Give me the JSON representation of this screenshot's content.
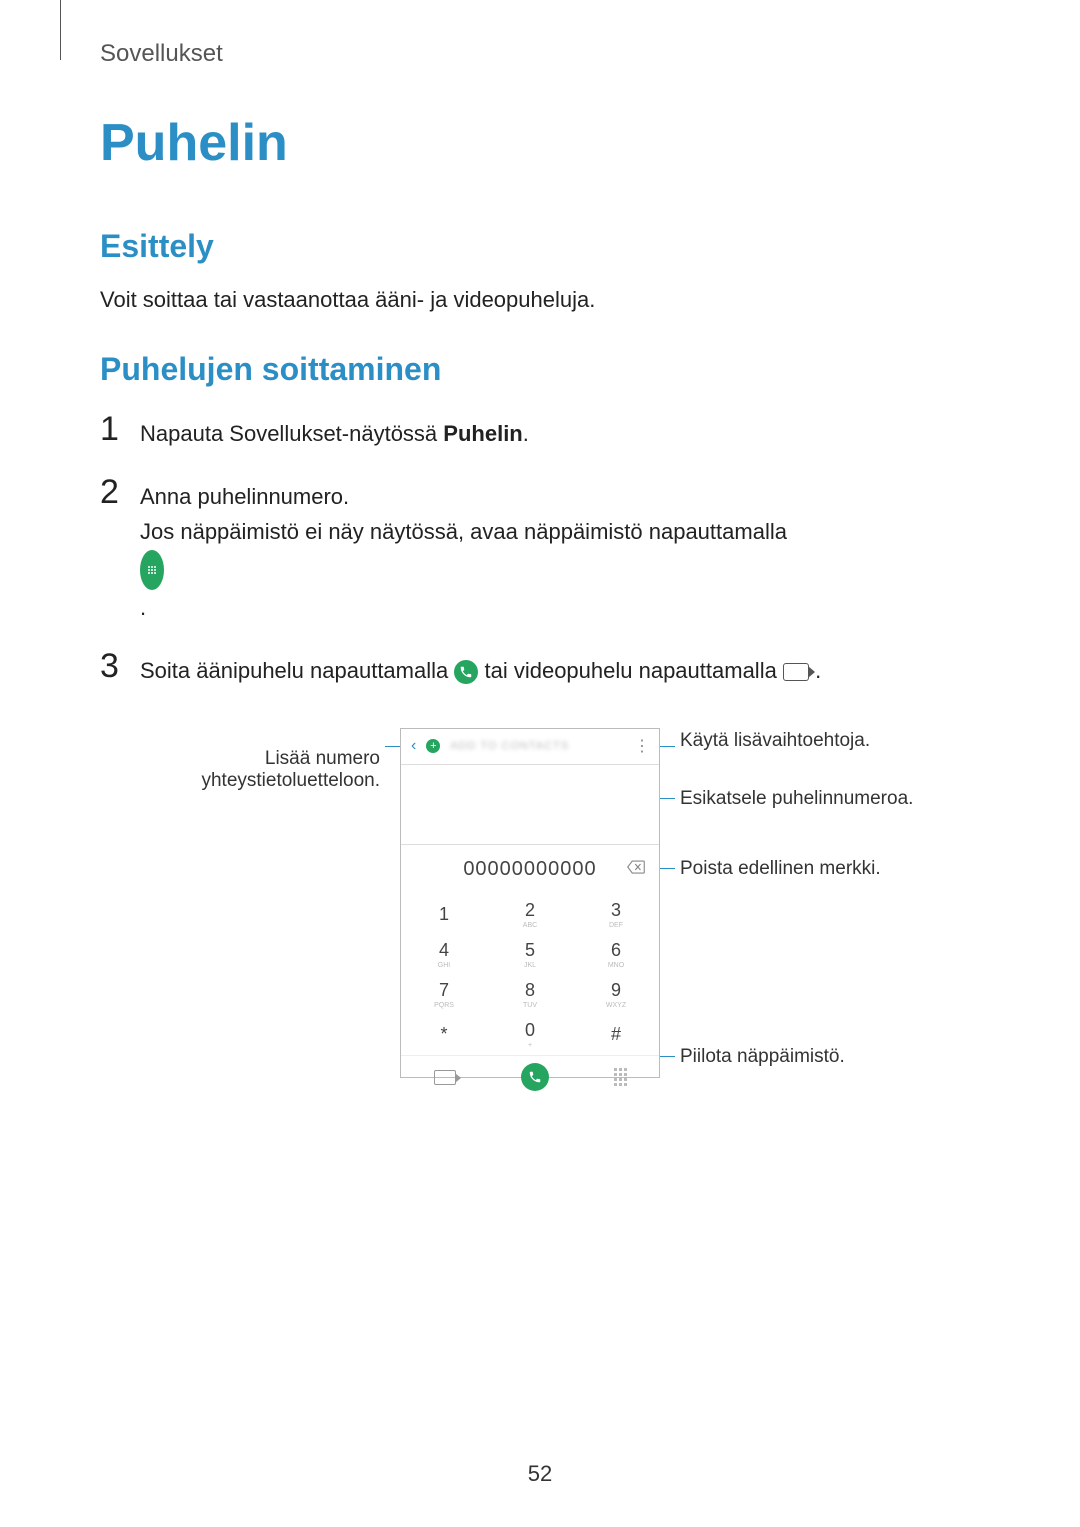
{
  "header": {
    "section": "Sovellukset"
  },
  "title": "Puhelin",
  "intro": {
    "heading": "Esittely",
    "text": "Voit soittaa tai vastaanottaa ääni- ja videopuheluja."
  },
  "making_calls": {
    "heading": "Puhelujen soittaminen",
    "steps": {
      "n1": "1",
      "n2": "2",
      "n3": "3",
      "s1_pre": "Napauta Sovellukset-näytössä ",
      "s1_bold": "Puhelin",
      "s1_post": ".",
      "s2_line1": "Anna puhelinnumero.",
      "s2_line2_pre": "Jos näppäimistö ei näy näytössä, avaa näppäimistö napauttamalla ",
      "s2_line2_post": ".",
      "s3_pre": "Soita äänipuhelu napauttamalla ",
      "s3_mid": " tai videopuhelu napauttamalla ",
      "s3_post": "."
    }
  },
  "phone_ui": {
    "add_contact_blur": "ADD TO CONTACTS",
    "number": "00000000000",
    "keys": [
      "1",
      "2",
      "3",
      "4",
      "5",
      "6",
      "7",
      "8",
      "9",
      "*",
      "0",
      "#"
    ],
    "subs": [
      "",
      "ABC",
      "DEF",
      "GHI",
      "JKL",
      "MNO",
      "PQRS",
      "TUV",
      "WXYZ",
      "",
      "+",
      ""
    ]
  },
  "callouts": {
    "add_contact": "Lisää numero yhteystietoluetteloon.",
    "more_options": "Käytä lisävaihtoehtoja.",
    "preview": "Esikatsele puhelinnumeroa.",
    "delete": "Poista edellinen merkki.",
    "hide_keypad": "Piilota näppäimistö."
  },
  "page_number": "52"
}
